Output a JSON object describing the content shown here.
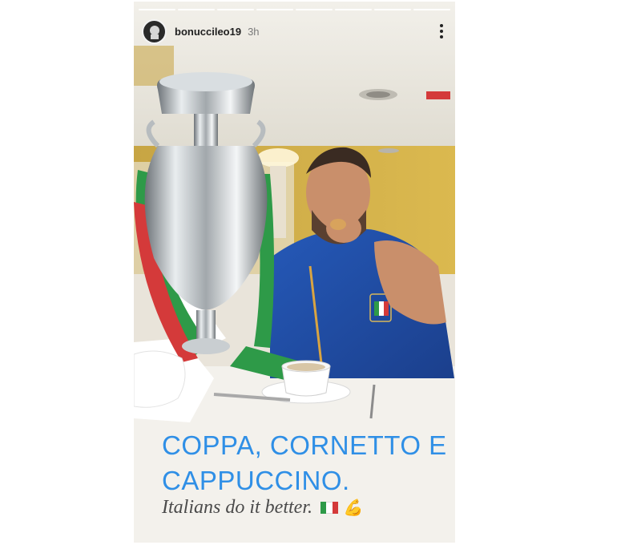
{
  "story": {
    "username": "bonuccileo19",
    "timestamp": "3h",
    "progress": {
      "segments": 8,
      "completed": 8
    }
  },
  "caption": {
    "line1": "COPPA, CORNETTO E",
    "line2": "CAPPUCCINO.",
    "subtitle": "Italians do it better.",
    "muscle_emoji": "💪"
  },
  "colors": {
    "caption_blue": "#2f8fe6",
    "flag_green": "#2e9a48",
    "flag_white": "#ffffff",
    "flag_red": "#d43a3a"
  },
  "icons": [
    "more-options-icon",
    "avatar",
    "italy-flag-icon",
    "flexed-biceps-icon"
  ]
}
